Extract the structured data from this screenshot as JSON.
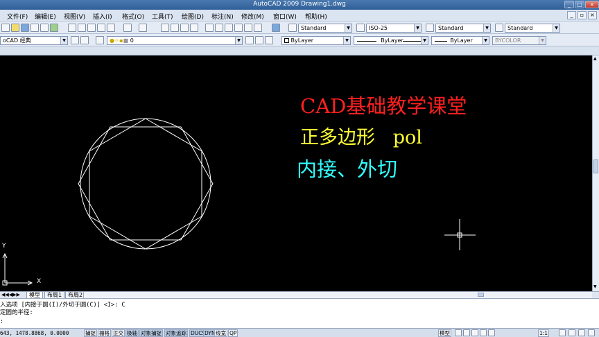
{
  "window": {
    "title": "AutoCAD 2009  Drawing1.dwg"
  },
  "menu": [
    "文件(F)",
    "编辑(E)",
    "视图(V)",
    "插入(I)",
    "格式(O)",
    "工具(T)",
    "绘图(D)",
    "标注(N)",
    "修改(M)",
    "窗口(W)",
    "帮助(H)"
  ],
  "toolbar": {
    "text_style": "Standard",
    "dim_style": "ISO-25",
    "table_style": "Standard",
    "multileader_style": "Standard"
  },
  "toolbar2": {
    "workspace": "oCAD 经典",
    "layer": "0"
  },
  "properties": {
    "color": "ByLayer",
    "linetype": "ByLayer",
    "lineweight": "ByLayer",
    "plotstyle": "BYCOLOR"
  },
  "overlay": {
    "line1": "CAD基础教学课堂",
    "line2": "正多边形   pol",
    "line3": "内接、外切",
    "colors": {
      "line1": "#ff2020",
      "line2": "#ffff33",
      "line3": "#33ffff"
    }
  },
  "ucs": {
    "y_label": "Y",
    "x_label": "X"
  },
  "layout_tabs": [
    "模型",
    "布局1",
    "布局2"
  ],
  "command": {
    "line1": "入选项 [内接于圆(I)/外切于圆(C)] <I>: C",
    "line2": "定圆的半径:",
    "prompt": ":"
  },
  "status": {
    "coords": "643, 1478.8868, 0.0000",
    "buttons": [
      "捕捉",
      "栅格",
      "正交",
      "极轴",
      "对象捕捉",
      "对象追踪",
      "DUCS",
      "DYN",
      "线宽",
      "QP"
    ],
    "model_label": "模型",
    "scale": "1:1"
  }
}
